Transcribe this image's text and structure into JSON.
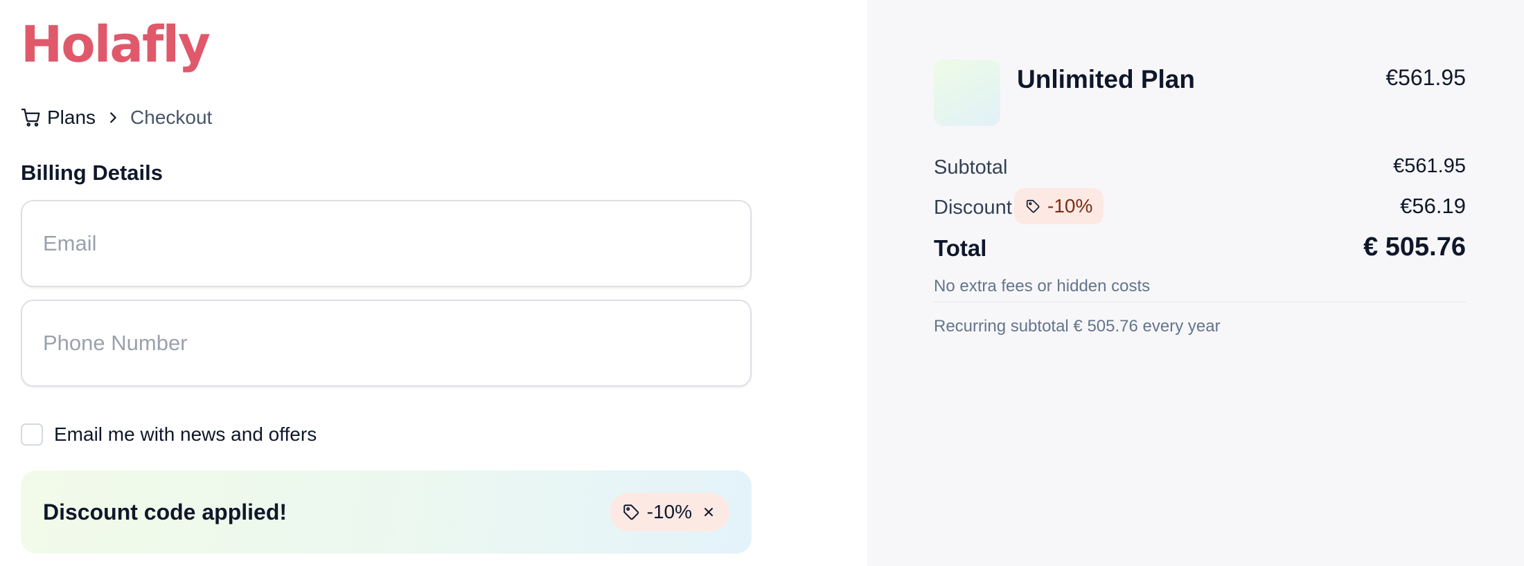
{
  "brand": {
    "logo_text": "Holafly",
    "color": "#e0596b"
  },
  "breadcrumb": {
    "plans_label": "Plans",
    "current_label": "Checkout"
  },
  "billing": {
    "title": "Billing Details",
    "email_placeholder": "Email",
    "phone_placeholder": "Phone Number",
    "newsletter_label": "Email me with news and offers",
    "newsletter_checked": false
  },
  "discount_banner": {
    "text": "Discount code applied!",
    "code_label": "-10%"
  },
  "summary": {
    "product_name": "Unlimited Plan",
    "product_price": "€561.95",
    "subtotal_label": "Subtotal",
    "subtotal_value": "€561.95",
    "discount_label": "Discount",
    "discount_badge": "-10%",
    "discount_value": "€56.19",
    "total_label": "Total",
    "total_value": "€ 505.76",
    "fees_note": "No extra fees or hidden costs",
    "recurring_note": "Recurring subtotal € 505.76 every year"
  },
  "icons": {
    "cart": "cart-icon",
    "chevron": "chevron-right-icon",
    "tag": "tag-icon",
    "close": "close-icon"
  },
  "colors": {
    "accent": "#e0596b",
    "summary_background": "#f7f7fa",
    "discount_pill": "#fde9e4"
  }
}
